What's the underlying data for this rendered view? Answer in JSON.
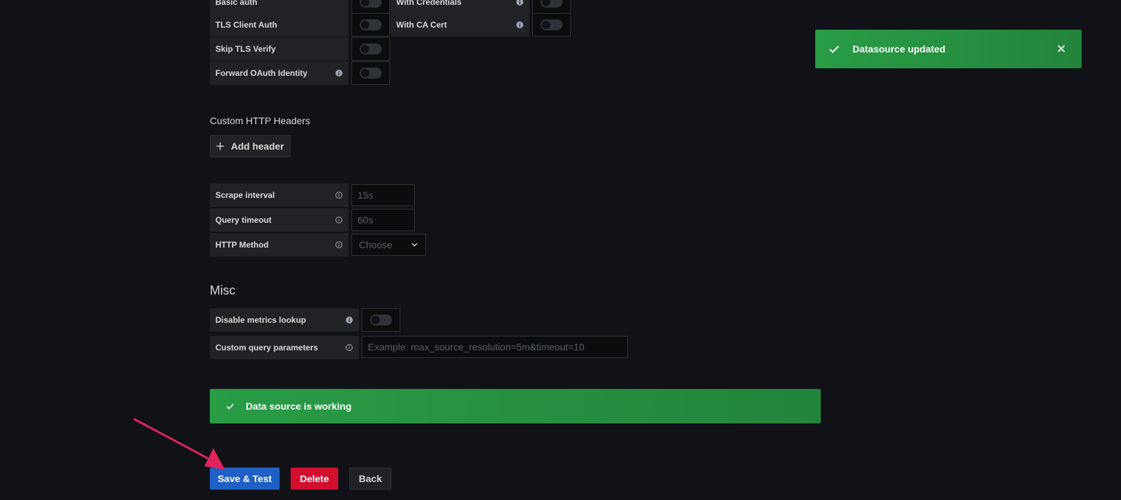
{
  "auth_rows": {
    "basic_auth": "Basic auth",
    "with_credentials": "With Credentials",
    "tls_client_auth": "TLS Client Auth",
    "with_ca_cert": "With CA Cert",
    "skip_tls_verify": "Skip TLS Verify",
    "forward_oauth": "Forward OAuth Identity"
  },
  "headers": {
    "title": "Custom HTTP Headers",
    "add_label": "Add header"
  },
  "prometheus": {
    "scrape_label": "Scrape interval",
    "scrape_placeholder": "15s",
    "timeout_label": "Query timeout",
    "timeout_placeholder": "60s",
    "method_label": "HTTP Method",
    "method_value": "Choose"
  },
  "misc": {
    "title": "Misc",
    "disable_lookup_label": "Disable metrics lookup",
    "custom_params_label": "Custom query parameters",
    "custom_params_placeholder": "Example: max_source_resolution=5m&timeout=10"
  },
  "status_banner": {
    "text": "Data source is working"
  },
  "toast": {
    "text": "Datasource updated"
  },
  "actions": {
    "save_label": "Save & Test",
    "delete_label": "Delete",
    "back_label": "Back"
  },
  "colors": {
    "success": "#299c46",
    "primary": "#1f60c4",
    "danger": "#d10e2e",
    "annotation_arrow": "#e0245e"
  }
}
